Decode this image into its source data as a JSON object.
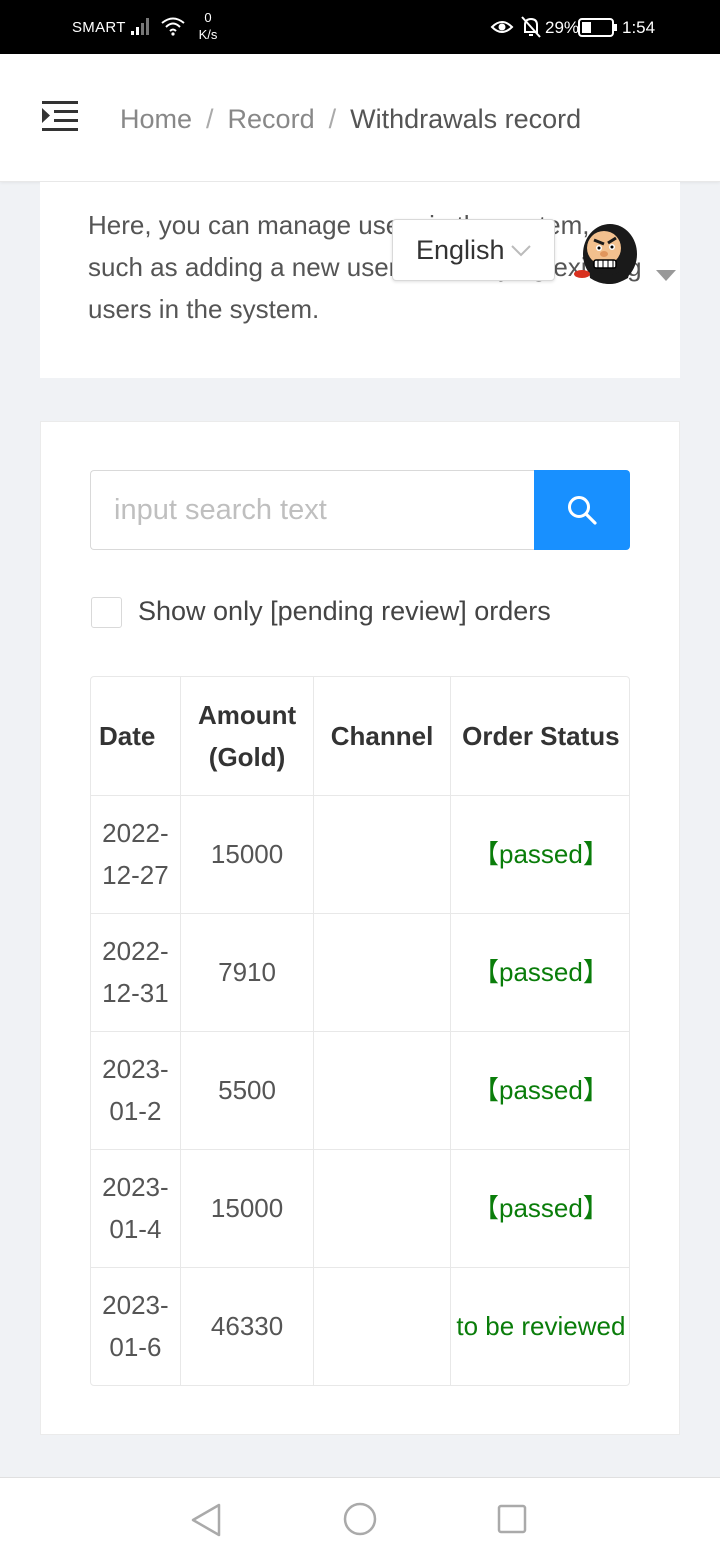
{
  "status_bar": {
    "carrier": "SMART",
    "speed_value": "0",
    "speed_unit": "K/s",
    "battery_percent": "29%",
    "time": "1:54"
  },
  "header": {
    "breadcrumb": [
      "Home",
      "Record",
      "Withdrawals record"
    ],
    "separator": "/"
  },
  "intro": {
    "text": "Here, you can manage users in the system, such as adding a new user or modifying existing users in the system."
  },
  "language": {
    "selected": "English"
  },
  "search": {
    "placeholder": "input search text"
  },
  "filter": {
    "checkbox_label": "Show only [pending review] orders",
    "checked": false
  },
  "table": {
    "columns": [
      "Date",
      "Amount (Gold)",
      "Channel",
      "Order Status"
    ],
    "rows": [
      {
        "date": [
          "2022-",
          "12-27"
        ],
        "amount": "15000",
        "channel": "",
        "status": "【passed】"
      },
      {
        "date": [
          "2022-",
          "12-31"
        ],
        "amount": "7910",
        "channel": "",
        "status": "【passed】"
      },
      {
        "date": [
          "2023-",
          "01-2"
        ],
        "amount": "5500",
        "channel": "",
        "status": "【passed】"
      },
      {
        "date": [
          "2023-",
          "01-4"
        ],
        "amount": "15000",
        "channel": "",
        "status": "【passed】"
      },
      {
        "date": [
          "2023-",
          "01-6"
        ],
        "amount": "46330",
        "channel": "",
        "status": "to be reviewed"
      }
    ]
  },
  "colors": {
    "primary": "#1890ff",
    "status_green": "#0a7d0a",
    "page_bg": "#f0f2f5"
  },
  "icons": {
    "menu": "menu-fold-icon",
    "search": "search-icon",
    "chevron": "chevron-down-icon",
    "caret": "caret-down-icon",
    "nav": [
      "back-icon",
      "home-icon",
      "recents-icon"
    ]
  }
}
